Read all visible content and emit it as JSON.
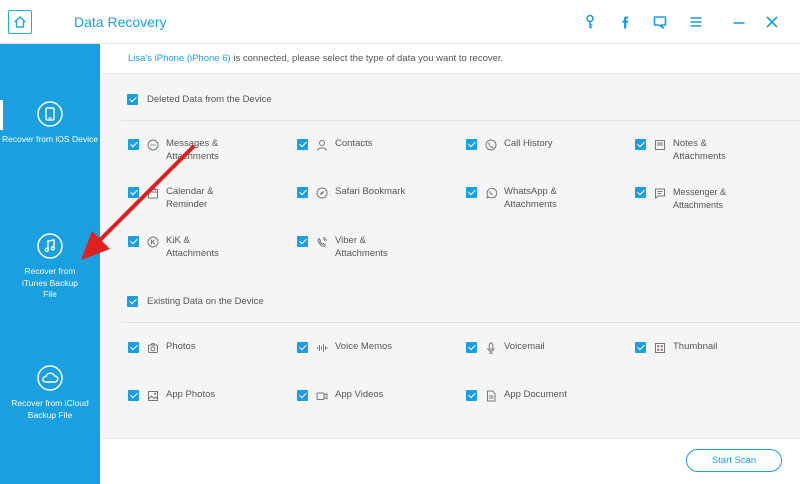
{
  "window": {
    "title": "Data Recovery"
  },
  "sidebar": {
    "items": [
      {
        "label": "Recover from iOS Device",
        "icon": "phone-recover-icon"
      },
      {
        "label": "Recover from iTunes Backup File",
        "icon": "music-note-icon"
      },
      {
        "label": "Recover from iCloud Backup File",
        "icon": "cloud-icon"
      }
    ]
  },
  "info": {
    "device": "Lisa's iPhone (iPhone 6)",
    "message": " is connected, please select the type of data you want to recover."
  },
  "sections": [
    {
      "title": "Deleted Data from the Device",
      "items": [
        {
          "label": "Messages & Attachments",
          "icon": "message-icon"
        },
        {
          "label": "Contacts",
          "icon": "contact-icon"
        },
        {
          "label": "Call History",
          "icon": "phone-icon"
        },
        {
          "label": "Notes & Attachments",
          "icon": "note-icon"
        },
        {
          "label": "Calendar & Reminder",
          "icon": "calendar-icon"
        },
        {
          "label": "Safari Bookmark",
          "icon": "compass-icon"
        },
        {
          "label": "WhatsApp & Attachments",
          "icon": "whatsapp-icon"
        },
        {
          "label": "Messenger & Attachments",
          "icon": "messenger-icon"
        },
        {
          "label": "KiK & Attachments",
          "icon": "kik-icon"
        },
        {
          "label": "Viber & Attachments",
          "icon": "viber-icon"
        }
      ]
    },
    {
      "title": "Existing Data on the Device",
      "items": [
        {
          "label": "Photos",
          "icon": "camera-icon"
        },
        {
          "label": "Voice Memos",
          "icon": "waveform-icon"
        },
        {
          "label": "Voicemail",
          "icon": "microphone-icon"
        },
        {
          "label": "Thumbnail",
          "icon": "grid-icon"
        },
        {
          "label": "App Photos",
          "icon": "image-icon"
        },
        {
          "label": "App Videos",
          "icon": "video-icon"
        },
        {
          "label": "App Document",
          "icon": "document-icon"
        }
      ]
    }
  ],
  "actions": {
    "scan_label": "Start Scan"
  },
  "colors": {
    "accent": "#1b9ee2",
    "sidebar": "#1a9fe0",
    "panel": "#f5f5f5",
    "arrow": "#e02020"
  }
}
